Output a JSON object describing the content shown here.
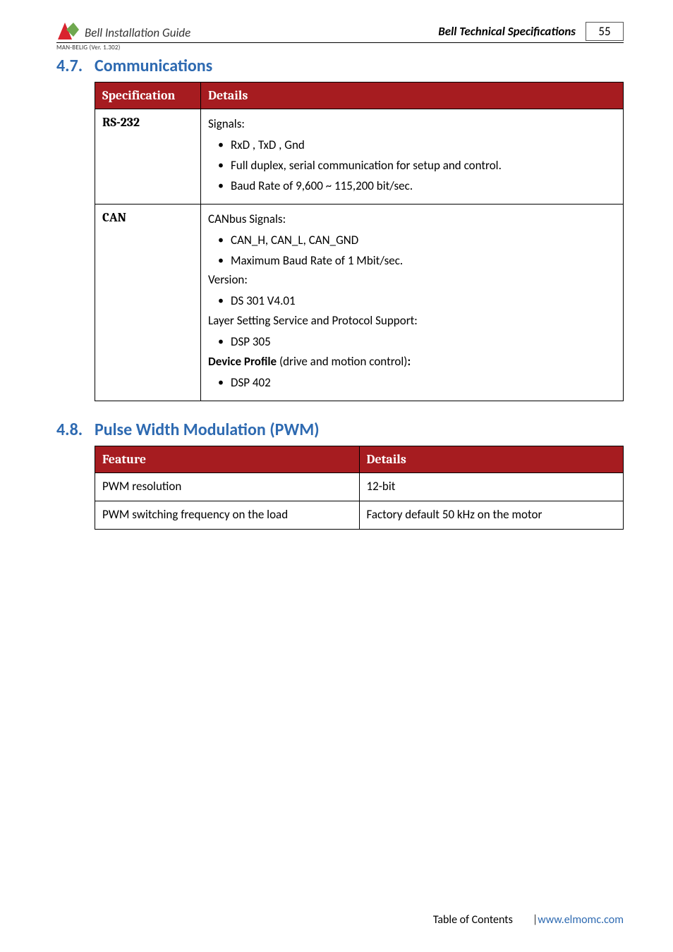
{
  "header": {
    "doc_title": "Bell Installation Guide",
    "section_title": "Bell Technical Specifications",
    "page_number": "55",
    "version_line": "MAN-BELIG (Ver. 1.302)"
  },
  "sections": {
    "communications": {
      "number": "4.7.",
      "title": "Communications",
      "table": {
        "headers": [
          "Specification",
          "Details"
        ],
        "rows": [
          {
            "label": "RS-232",
            "blocks": [
              {
                "heading": "Signals:",
                "items": [
                  "RxD , TxD , Gnd",
                  "Full duplex, serial communication for setup and control.",
                  "Baud Rate of 9,600 ~ 115,200 bit/sec."
                ]
              }
            ]
          },
          {
            "label": "CAN",
            "blocks": [
              {
                "heading": "CANbus Signals:",
                "items": [
                  "CAN_H, CAN_L, CAN_GND",
                  "Maximum Baud Rate of 1 Mbit/sec."
                ]
              },
              {
                "heading": "Version:",
                "items": [
                  "DS 301 V4.01"
                ]
              },
              {
                "heading": "Layer Setting Service and Protocol Support:",
                "items": [
                  "DSP 305"
                ]
              },
              {
                "heading_bold_prefix": "Device Profile",
                "heading_rest": " (drive and motion control)",
                "heading_suffix": ":",
                "items": [
                  "DSP 402"
                ]
              }
            ]
          }
        ]
      }
    },
    "pwm": {
      "number": "4.8.",
      "title": "Pulse Width Modulation (PWM)",
      "table": {
        "headers": [
          "Feature",
          "Details"
        ],
        "rows": [
          {
            "feature": "PWM resolution",
            "details": "12-bit"
          },
          {
            "feature": "PWM switching frequency on the load",
            "details": "Factory default 50 kHz on the motor"
          }
        ]
      }
    }
  },
  "footer": {
    "toc": "Table of Contents",
    "sep": "|",
    "link": "www.elmomc.com"
  }
}
